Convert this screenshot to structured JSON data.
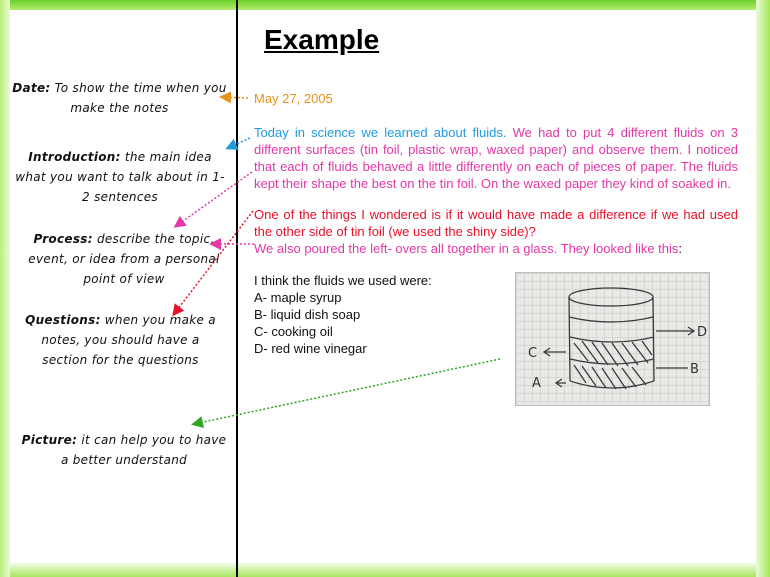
{
  "title": "Example",
  "notes": {
    "date": {
      "term": "Date:",
      "text": "To show the time when you make the notes"
    },
    "intro": {
      "term": "Introduction:",
      "text": "the main idea what you want to talk about in 1-2 sentences"
    },
    "process": {
      "term": "Process:",
      "text": "describe the topic, event, or idea from a personal point of view"
    },
    "questions": {
      "term": "Questions:",
      "text": "when you make a notes, you should have a section for the questions"
    },
    "picture": {
      "term": "Picture:",
      "text": "it can help you to have a better understand"
    }
  },
  "content": {
    "date": "May 27, 2005",
    "intro": "Today in science we learned about fluids.",
    "process": "We had to put 4 different fluids on 3 different surfaces (tin foil, plastic wrap, waxed paper) and observe them. I noticed that each of fluids behaved a little differently on each of pieces of paper. The fluids kept their shape the best on the tin foil. On the waxed paper they kind of soaked in.",
    "question": "One of the things I wondered is if it would have made a difference if we had used the other side of tin foil (we used the shiny side)?",
    "glass_text": "We also poured the left- overs all together in a glass. They looked like this",
    "glass_colon": ":",
    "list_intro": "I think the fluids we used were:",
    "list": [
      "A- maple syrup",
      "B- liquid dish soap",
      "C- cooking oil",
      "D- red wine vinegar"
    ]
  },
  "drawing_labels": {
    "a": "A",
    "b": "B",
    "c": "C",
    "d": "D"
  },
  "colors": {
    "date": "#e8921c",
    "intro": "#1f9be0",
    "process": "#e238a8",
    "question": "#e8112a",
    "picture_arrow": "#2aa824"
  }
}
